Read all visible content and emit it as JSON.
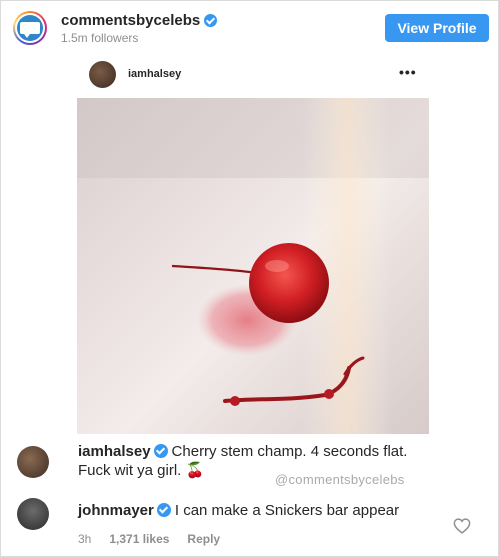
{
  "header": {
    "username": "commentsbycelebs",
    "followers": "1.5m followers",
    "view_profile": "View Profile"
  },
  "embedded_post": {
    "username": "iamhalsey",
    "more": "•••"
  },
  "comments": [
    {
      "username": "iamhalsey",
      "text": "Cherry stem champ. 4 seconds flat. Fuck wit ya girl. 🍒",
      "watermark": "@commentsbycelebs"
    },
    {
      "username": "johnmayer",
      "text": "I can make a Snickers bar appear",
      "time": "3h",
      "likes": "1,371 likes",
      "reply": "Reply"
    }
  ],
  "colors": {
    "accent": "#3897f0",
    "text": "#262626",
    "muted": "#8e8e8e"
  }
}
